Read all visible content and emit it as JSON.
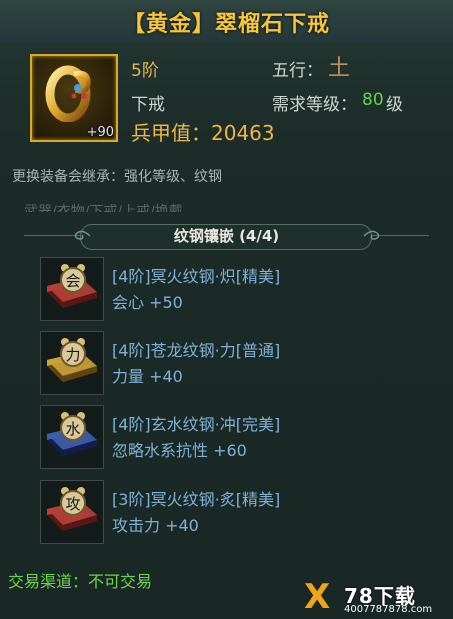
{
  "title": "【黄金】翠榴石下戒",
  "item": {
    "enhance": "+90",
    "stage": "5阶",
    "type": "下戒",
    "wuxing_label": "五行：",
    "wuxing_value": "土",
    "req_label": "需求等级：",
    "req_value": "80",
    "req_unit": "级",
    "power_label": "兵甲值：",
    "power_value": "20463"
  },
  "inherit_note": "更换装备会继承：强化等级、纹钢",
  "partial_row": "武器/衣物/下戒/上戒/换戴",
  "section": {
    "title": "纹钢镶嵌 (4/4)"
  },
  "gems": [
    {
      "char": "会",
      "name": "[4阶]冥火纹钢·炽[精美]",
      "stat": "会心  +50",
      "color": "red"
    },
    {
      "char": "力",
      "name": "[4阶]苍龙纹钢·力[普通]",
      "stat": "力量  +40",
      "color": "yellow"
    },
    {
      "char": "水",
      "name": "[4阶]玄水纹钢·冲[完美]",
      "stat": "忽略水系抗性  +60",
      "color": "blue"
    },
    {
      "char": "攻",
      "name": "[3阶]冥火纹钢·炙[精美]",
      "stat": "攻击力  +40",
      "color": "red"
    }
  ],
  "trade": "交易渠道：不可交易",
  "watermark": {
    "brand": "78下载",
    "url": "4007787878.com"
  },
  "colors": {
    "gold": "#f5c63a",
    "green": "#66d24a",
    "gem_text": "#7fb2d8"
  }
}
